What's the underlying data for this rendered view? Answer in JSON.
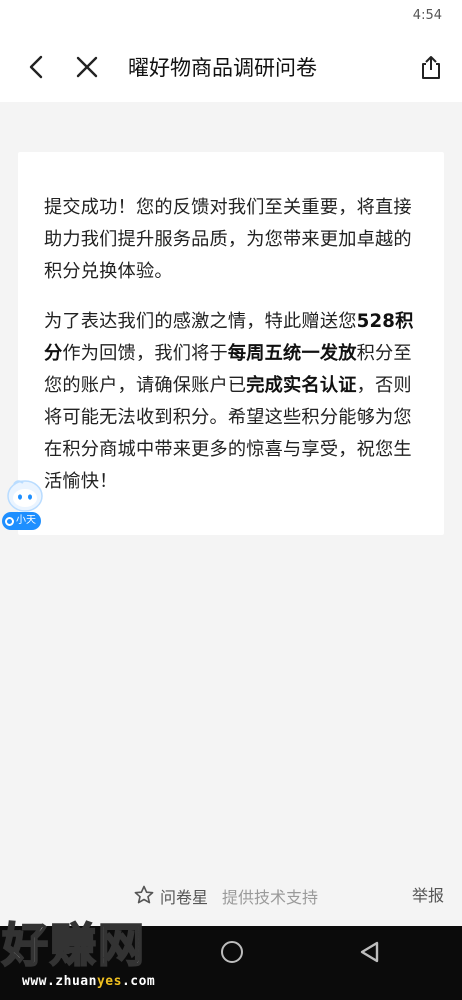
{
  "status_bar": {
    "time": "4:54"
  },
  "nav": {
    "title": "曜好物商品调研问卷",
    "icons": {
      "back": "back-chevron-icon",
      "close": "close-icon",
      "share": "share-icon"
    }
  },
  "content": {
    "paragraph1": "提交成功！您的反馈对我们至关重要，将直接助力我们提升服务品质，为您带来更加卓越的积分兑换体验。",
    "p2_part1": "为了表达我们的感激之情，特此赠送您",
    "p2_points": "528积分",
    "p2_part2": "作为回馈，我们将于",
    "p2_schedule": "每周五统一发放",
    "p2_part3": "积分至您的账户，请确保账户已",
    "p2_verify": "完成实名认证",
    "p2_part4": "，否则将可能无法收到积分。希望这些积分能够为您在积分商城中带来更多的惊喜与享受，祝您生活愉快！"
  },
  "assistant": {
    "label": "小天",
    "icon": "assistant-avatar-icon"
  },
  "footer": {
    "brand": "问卷星",
    "support": "提供技术支持",
    "report": "举报",
    "star_icon": "star-icon"
  },
  "watermark": {
    "main": "好赚网",
    "url_pre": "www.zhuan",
    "url_hl": "yes",
    "url_post": ".com"
  },
  "colors": {
    "accent": "#1e8fff",
    "background": "#f4f4f4",
    "card": "#ffffff",
    "nav_bar_system": "#0b0b0b"
  }
}
